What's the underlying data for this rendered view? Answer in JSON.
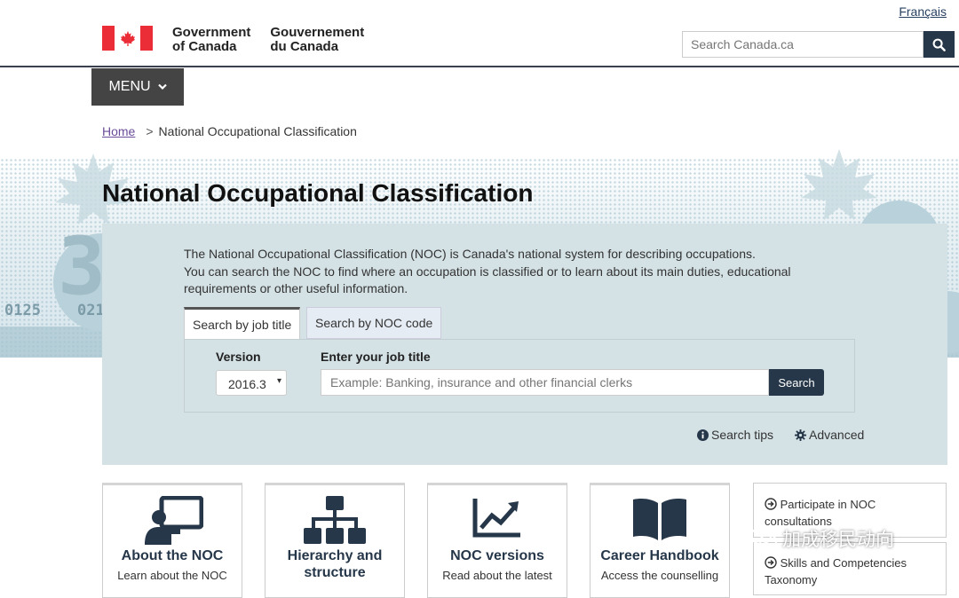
{
  "header": {
    "language_link": "Français",
    "gov_name_en": [
      "Government",
      "of Canada"
    ],
    "gov_name_fr": [
      "Gouvernement",
      "du Canada"
    ],
    "search_placeholder": "Search Canada.ca",
    "menu_label": "MENU"
  },
  "breadcrumb": {
    "home": "Home",
    "current": "National Occupational Classification"
  },
  "banner": {
    "numbers": [
      "0125",
      "021",
      "3"
    ]
  },
  "page": {
    "title": "National Occupational Classification",
    "intro_1": "The National Occupational Classification (NOC) is Canada's national system for describing occupations.",
    "intro_2": "You can search the NOC to find where an occupation is classified or to learn about its main duties, educational requirements or other useful information."
  },
  "search_form": {
    "tabs": [
      "Search by job title",
      "Search by NOC code"
    ],
    "version_label": "Version",
    "version_value": "2016.3",
    "job_label": "Enter your job title",
    "job_placeholder": "Example: Banking, insurance and other financial clerks",
    "search_button": "Search",
    "search_tips": "Search tips",
    "advanced": "Advanced"
  },
  "cards": [
    {
      "title": "About the NOC",
      "desc": "Learn about the NOC",
      "icon": "presenter-icon"
    },
    {
      "title": "Hierarchy and structure",
      "title_lines": [
        "Hierarchy and",
        "structure"
      ],
      "desc": "",
      "icon": "hierarchy-icon"
    },
    {
      "title": "NOC versions",
      "desc": "Read about the latest",
      "icon": "trend-chart-icon"
    },
    {
      "title": "Career Handbook",
      "desc": "Access the counselling",
      "icon": "book-icon"
    }
  ],
  "side_links": [
    {
      "label": "Participate in NOC consultations",
      "lines": [
        "Participate in NOC",
        "consultations"
      ],
      "icon": "arrow-circle-icon"
    },
    {
      "label": "Skills and Competencies Taxonomy",
      "lines": [
        "Skills and Competencies",
        "Taxonomy"
      ],
      "icon": "arrow-circle-icon"
    }
  ],
  "watermark": {
    "text": "加成移民动向",
    "icon": "wechat-icon"
  },
  "colors": {
    "navy": "#26374a",
    "flag_red": "#eb2d37",
    "panel": "#d4e1e5",
    "menu": "#444444"
  }
}
